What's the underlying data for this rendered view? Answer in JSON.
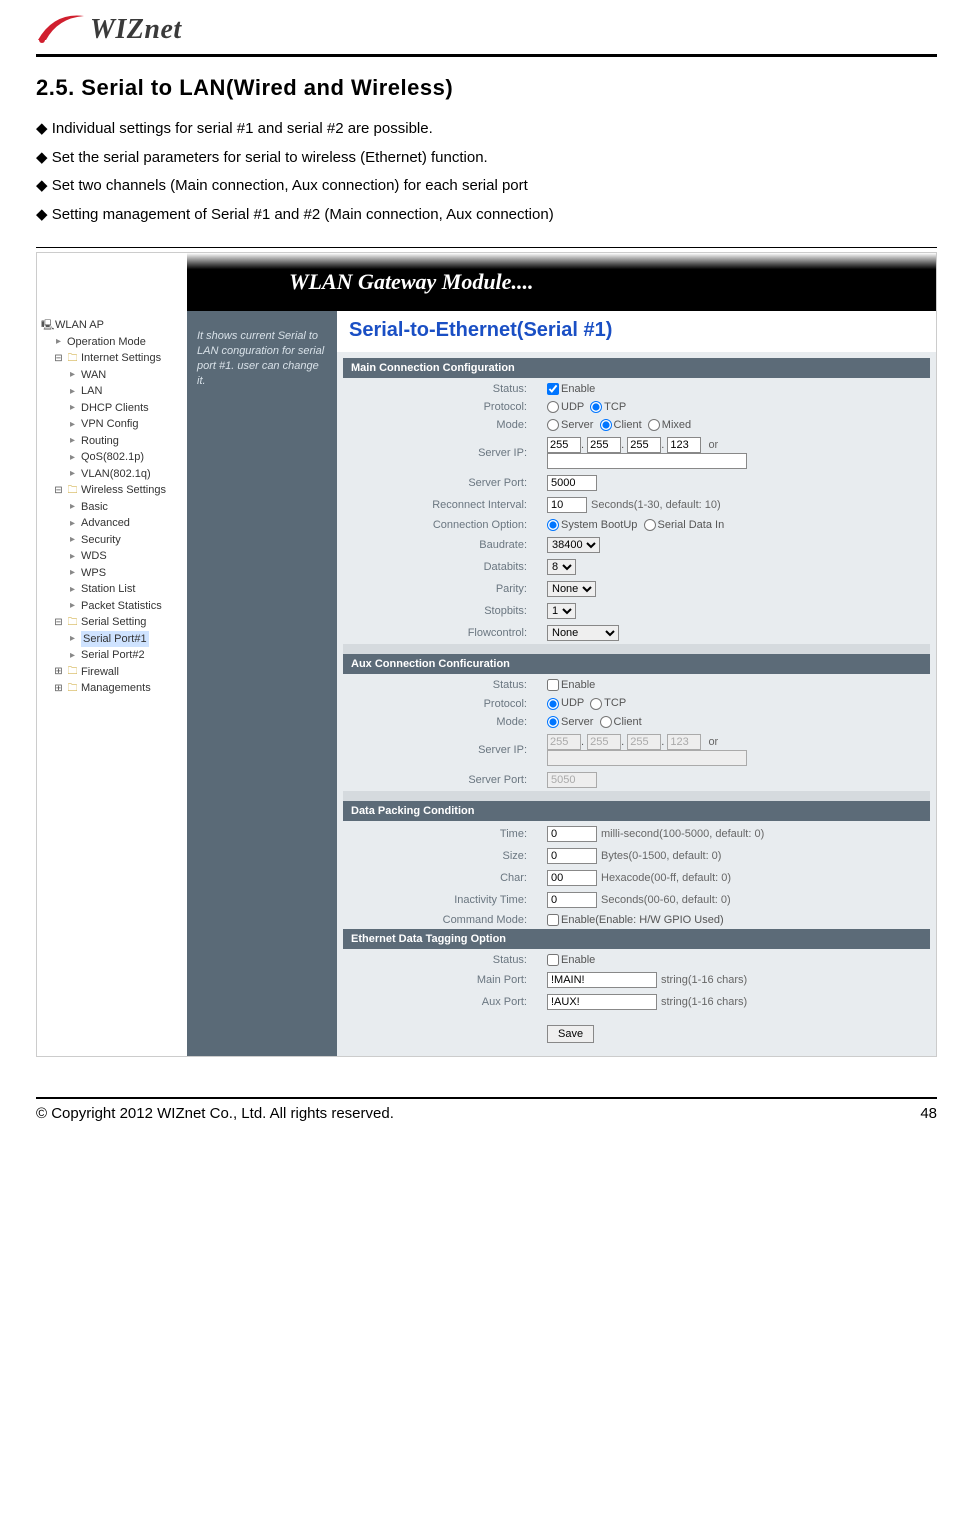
{
  "logo_text": "WIZnet",
  "section_title": "2.5.  Serial  to  LAN(Wired  and  Wireless)",
  "bullets": [
    "Individual settings for serial #1 and serial #2 are possible.",
    "Set the serial parameters for serial to wireless (Ethernet) function.",
    "Set two channels (Main connection, Aux connection) for each serial port",
    "Setting management of Serial #1 and #2 (Main connection, Aux connection)"
  ],
  "banner_title": "WLAN Gateway Module....",
  "tree": {
    "root": "WLAN AP",
    "items": [
      "Operation Mode",
      "Internet Settings",
      "WAN",
      "LAN",
      "DHCP Clients",
      "VPN Config",
      "Routing",
      "QoS(802.1p)",
      "VLAN(802.1q)",
      "Wireless Settings",
      "Basic",
      "Advanced",
      "Security",
      "WDS",
      "WPS",
      "Station List",
      "Packet Statistics",
      "Serial Setting",
      "Serial Port#1",
      "Serial Port#2",
      "Firewall",
      "Managements"
    ]
  },
  "desc_text": "It shows current Serial to LAN conguration for serial port #1. user can change it.",
  "content_title": "Serial-to-Ethernet(Serial #1)",
  "sections": {
    "main": "Main Connection Configuration",
    "aux": "Aux Connection Conficuration",
    "pack": "Data Packing Condition",
    "tag": "Ethernet Data Tagging Option"
  },
  "labels": {
    "status": "Status:",
    "protocol": "Protocol:",
    "mode": "Mode:",
    "server_ip": "Server IP:",
    "server_port": "Server Port:",
    "reconnect": "Reconnect Interval:",
    "conn_opt": "Connection Option:",
    "baud": "Baudrate:",
    "databits": "Databits:",
    "parity": "Parity:",
    "stopbits": "Stopbits:",
    "flow": "Flowcontrol:",
    "time": "Time:",
    "size": "Size:",
    "char": "Char:",
    "inact": "Inactivity Time:",
    "cmd": "Command Mode:",
    "main_port": "Main Port:",
    "aux_port": "Aux Port:"
  },
  "values": {
    "enable": "Enable",
    "udp": "UDP",
    "tcp": "TCP",
    "server": "Server",
    "client": "Client",
    "mixed": "Mixed",
    "ip1": "255",
    "ip2": "255",
    "ip3": "255",
    "ip4": "123",
    "or": "or",
    "port_main": "5000",
    "recon": "10",
    "recon_hint": "Seconds(1-30, default: 10)",
    "sys_boot": "System BootUp",
    "ser_data": "Serial Data In",
    "baud": "38400",
    "databits": "8",
    "parity": "None",
    "stopbits": "1",
    "flow": "None",
    "aux_port": "5050",
    "time_v": "0",
    "time_hint": "milli-second(100-5000, default: 0)",
    "size_v": "0",
    "size_hint": "Bytes(0-1500, default: 0)",
    "char_v": "00",
    "char_hint": "Hexacode(00-ff, default: 0)",
    "inact_v": "0",
    "inact_hint": "Seconds(00-60, default: 0)",
    "cmd_hint": "Enable(Enable: H/W GPIO Used)",
    "tag_main": "!MAIN!",
    "tag_aux": "!AUX!",
    "tag_hint": "string(1-16 chars)",
    "save": "Save"
  },
  "footer": {
    "copyright": "© Copyright 2012 WIZnet Co., Ltd. All rights reserved.",
    "page": "48"
  }
}
